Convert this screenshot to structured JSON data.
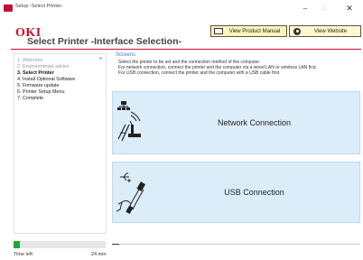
{
  "window": {
    "title": "Setup -Select Printer-",
    "minimize_glyph": "–",
    "maximize_glyph": "□",
    "close_glyph": "✕"
  },
  "header": {
    "logo_text": "OKI",
    "page_title": "Select Printer -Interface Selection-",
    "manual_button_label": "View Product Manual",
    "website_button_label": "View Website",
    "accent_color": "#c8102e",
    "button_color": "#fff5b8"
  },
  "sidebar": {
    "toggle_label": "«",
    "steps": [
      {
        "label": "1. Welcome",
        "state": "done"
      },
      {
        "label": "2. Environmental advice",
        "state": "done"
      },
      {
        "label": "3. Select Printer",
        "state": "current"
      },
      {
        "label": "4. Install Optional Software",
        "state": "todo"
      },
      {
        "label": "5. Firmware update",
        "state": "todo"
      },
      {
        "label": "6. Printer Setup Menu",
        "state": "todo"
      },
      {
        "label": "7. Complete",
        "state": "todo"
      }
    ]
  },
  "progress": {
    "fraction": 0.07,
    "time_left_label": "Time left",
    "time_left_value": "24 min",
    "color": "#22a83a"
  },
  "main": {
    "section_label": "Screens",
    "instructions": [
      "Select the printer to be set and the connection method of the computer.",
      "For network connection, connect the printer and the computer via a wired LAN or wireless LAN first.",
      "For USB connection, connect the printer and the computer with a USB cable first."
    ],
    "network_label": "Network Connection",
    "network_icon": "network-connection-icon",
    "usb_label": "USB Connection",
    "usb_icon": "usb-cable-icon",
    "card_color": "#dcedfa"
  }
}
